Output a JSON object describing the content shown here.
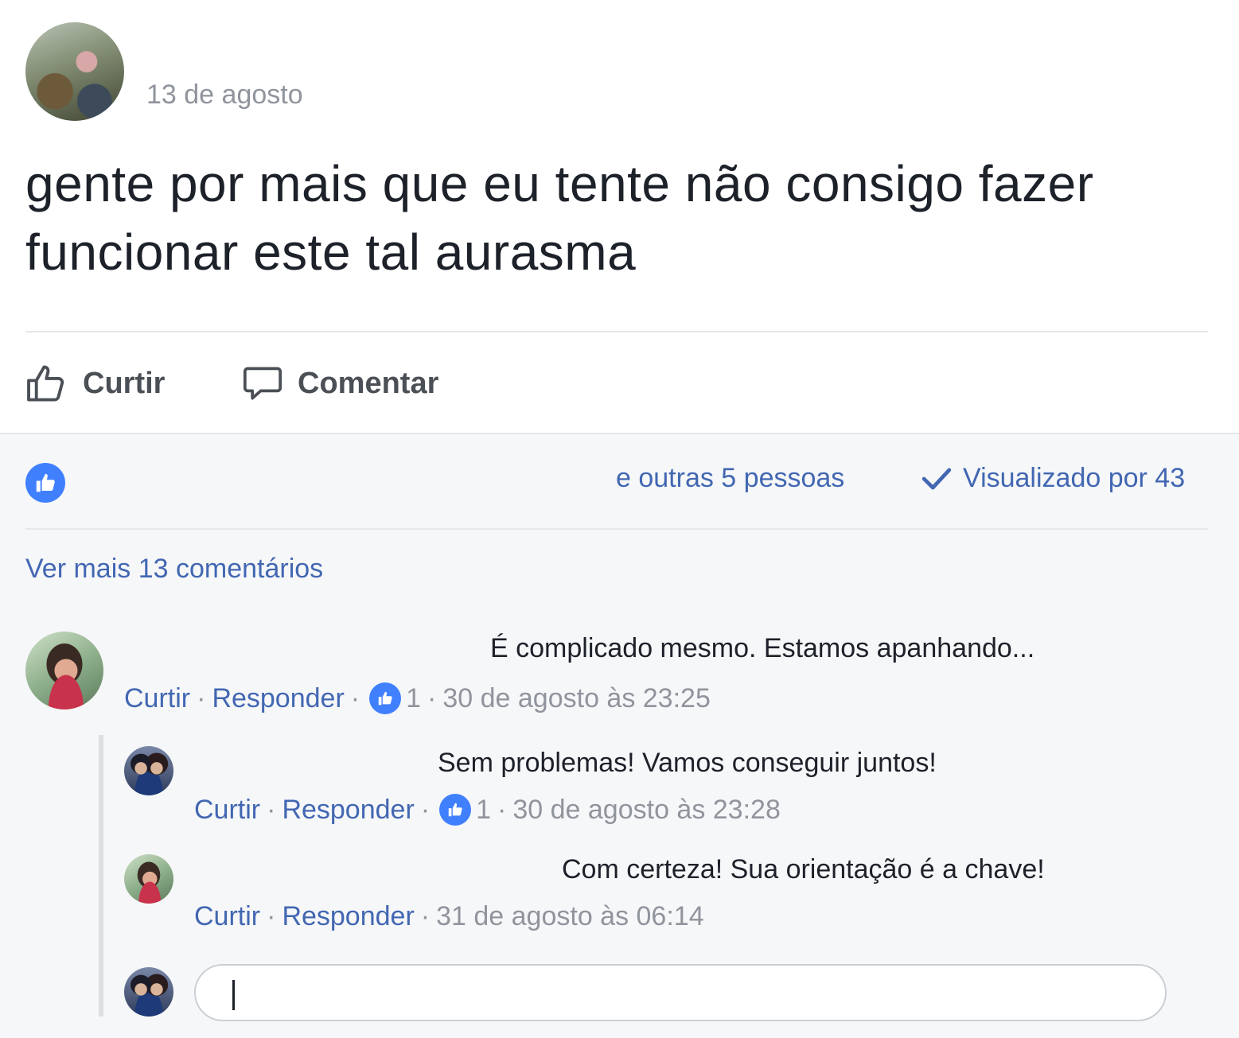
{
  "post": {
    "date": "13 de agosto",
    "text": "gente por mais que eu tente não consigo fazer funcionar este tal aurasma"
  },
  "actions": {
    "like_label": "Curtir",
    "comment_label": "Comentar"
  },
  "reactions": {
    "others_text": "e outras 5 pessoas",
    "seen_text": "Visualizado por 43"
  },
  "more_comments_label": "Ver mais 13 comentários",
  "comments": [
    {
      "text": "É complicado mesmo. Estamos apanhando...",
      "like_label": "Curtir",
      "reply_label": "Responder",
      "like_count": "1",
      "timestamp": "30 de agosto às 23:25"
    }
  ],
  "replies": [
    {
      "text": "Sem problemas! Vamos conseguir juntos!",
      "like_label": "Curtir",
      "reply_label": "Responder",
      "like_count": "1",
      "timestamp": "30 de agosto às 23:28"
    },
    {
      "text": "Com certeza! Sua orientação é a chave!",
      "like_label": "Curtir",
      "reply_label": "Responder",
      "timestamp": "31 de agosto às 06:14"
    }
  ],
  "reply_input": {
    "value": ""
  },
  "colors": {
    "link": "#4267b2",
    "muted": "#90949c",
    "like_blue": "#4080ff",
    "gray_bg": "#f6f7f9"
  }
}
